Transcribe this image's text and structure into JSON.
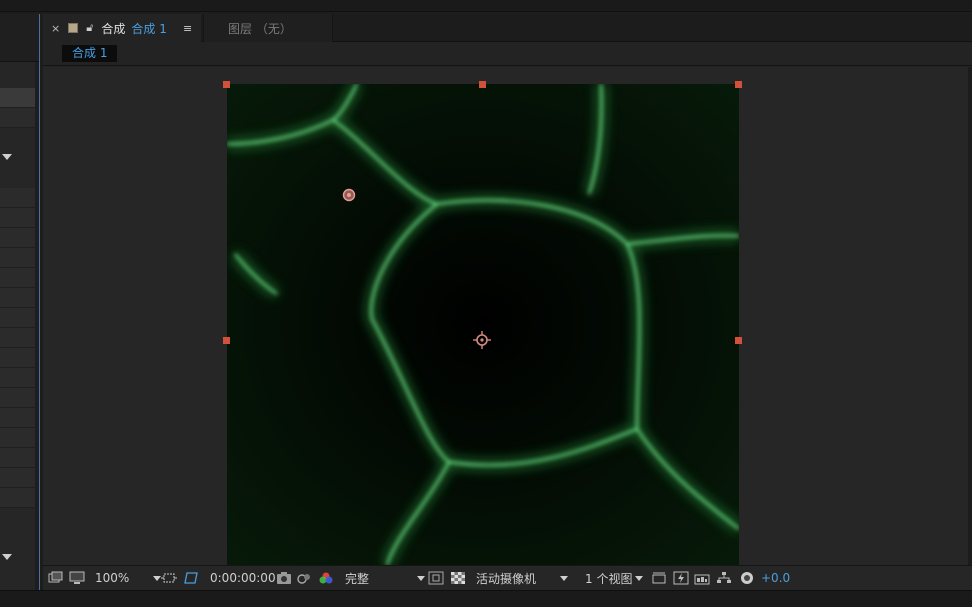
{
  "comp_tab": {
    "close": "×",
    "prefix": "合成",
    "name": "合成 1",
    "menu": "≡"
  },
  "layer_tab": {
    "label": "图层 （无）"
  },
  "breadcrumb": {
    "label": "合成 1"
  },
  "toolbar": {
    "zoom": "100%",
    "timecode": "0:00:00:00",
    "resolution": "完整",
    "camera": "活动摄像机",
    "views": "1 个视图",
    "exposure": "+0.0"
  },
  "colors": {
    "accent": "#4a9fe0",
    "handle": "#d2513a",
    "glow": "#5cd87a",
    "panel_border": "#4d6f9a"
  },
  "icons": [
    "close-icon",
    "lock-icon",
    "menu-icon",
    "monitor-icon",
    "display-icon",
    "region-icon",
    "transparency-grid-icon",
    "snapshot-icon",
    "show-snapshot-icon",
    "color-channel-icon",
    "fast-preview-icon",
    "checkerboard-icon",
    "camera-dropdown-icon",
    "reset-exposure-icon",
    "flowchart-icon",
    "exposure-icon"
  ]
}
